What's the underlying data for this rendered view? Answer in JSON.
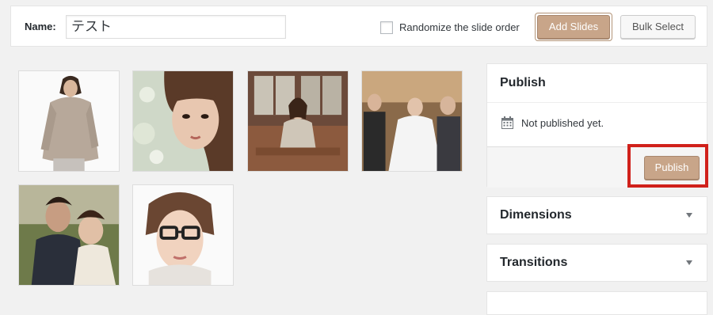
{
  "toolbar": {
    "name_label": "Name:",
    "name_value": "テスト",
    "randomize_label": "Randomize the slide order",
    "randomize_checked": false,
    "add_slides_label": "Add Slides",
    "bulk_select_label": "Bulk Select"
  },
  "slides": [
    {
      "icon": "woman-in-sweater-photo"
    },
    {
      "icon": "woman-portrait-photo"
    },
    {
      "icon": "woman-on-bench-photo"
    },
    {
      "icon": "wedding-family-photo"
    },
    {
      "icon": "couple-photo"
    },
    {
      "icon": "woman-with-glasses-photo"
    }
  ],
  "sidebar": {
    "publish": {
      "title": "Publish",
      "status_icon": "calendar-icon",
      "status_text": "Not published yet.",
      "publish_button_label": "Publish"
    },
    "dimensions": {
      "title": "Dimensions"
    },
    "transitions": {
      "title": "Transitions"
    },
    "partial": {
      "title": ""
    }
  },
  "colors": {
    "primary_button": "#c8a589",
    "highlight": "#d0211b",
    "background": "#f1f1f1"
  }
}
